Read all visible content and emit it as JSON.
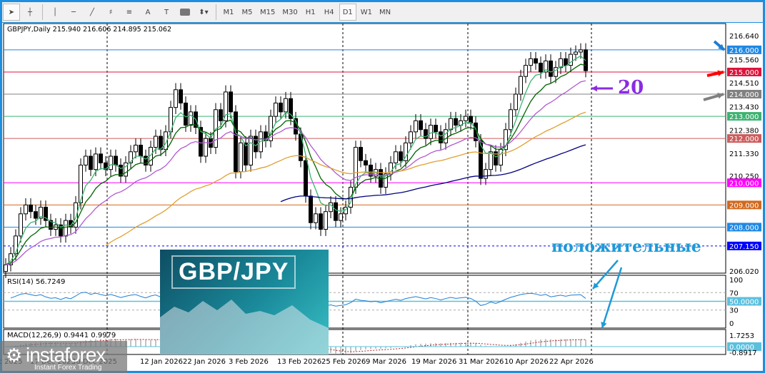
{
  "toolbar": {
    "timeframes": [
      "M1",
      "M5",
      "M15",
      "M30",
      "H1",
      "H4",
      "D1",
      "W1",
      "MN"
    ],
    "selected": "D1",
    "text_tool": "A"
  },
  "chart": {
    "header": "GBPJPY,Daily  215.940 216.606 214.895 215.062",
    "price_scale": [
      "216.640",
      "215.560",
      "214.510",
      "213.430",
      "212.380",
      "211.330",
      "210.250",
      "206.020"
    ],
    "levels": [
      {
        "price": 216.0,
        "label": "216.000",
        "color": "#1e88e5"
      },
      {
        "price": 215.0,
        "label": "215.000",
        "color": "#dc143c"
      },
      {
        "price": 214.0,
        "label": "214.000",
        "color": "#808080"
      },
      {
        "price": 213.0,
        "label": "213.000",
        "color": "#3cb371"
      },
      {
        "price": 212.0,
        "label": "212.000",
        "color": "#cd5c5c"
      },
      {
        "price": 210.0,
        "label": "210.000",
        "color": "#ff00ff"
      },
      {
        "price": 209.0,
        "label": "209.000",
        "color": "#d2691e"
      },
      {
        "price": 208.0,
        "label": "208.000",
        "color": "#1e88e5"
      },
      {
        "price": 207.15,
        "label": "207.150",
        "color": "#0000ff"
      }
    ],
    "dates": [
      "5 Dec 2025",
      "17 Dec 2025",
      "30 Dec 2025",
      "12 Jan 2026",
      "22 Jan 2026",
      "3 Feb 2026",
      "13 Feb 2026",
      "25 Feb 2026",
      "9 Mar 2026",
      "19 Mar 2026",
      "31 Mar 2026",
      "10 Apr 2026",
      "22 Apr 2026"
    ],
    "closes": [
      206.3,
      206.8,
      207.6,
      208.6,
      209.0,
      208.7,
      208.4,
      208.9,
      208.3,
      207.9,
      208.1,
      207.6,
      208.3,
      208.0,
      209.1,
      210.8,
      211.2,
      210.6,
      211.3,
      210.9,
      210.6,
      211.2,
      210.8,
      210.3,
      210.9,
      211.4,
      211.7,
      211.2,
      210.8,
      211.6,
      212.1,
      211.5,
      212.3,
      213.4,
      214.2,
      213.6,
      212.6,
      213.2,
      212.5,
      211.2,
      212.0,
      211.6,
      213.3,
      212.8,
      214.1,
      213.2,
      210.5,
      211.8,
      210.8,
      212.1,
      211.4,
      212.3,
      211.9,
      213.0,
      213.6,
      213.2,
      213.8,
      212.9,
      212.2,
      211.0,
      209.4,
      208.2,
      208.6,
      207.9,
      208.7,
      209.1,
      208.3,
      208.6,
      208.9,
      209.8,
      211.6,
      211.0,
      210.8,
      210.3,
      210.6,
      209.8,
      210.4,
      210.9,
      211.4,
      211.0,
      211.8,
      212.3,
      212.8,
      212.4,
      212.0,
      212.6,
      212.3,
      211.8,
      212.4,
      212.9,
      212.6,
      212.8,
      213.0,
      212.7,
      211.9,
      210.2,
      210.6,
      211.4,
      210.8,
      211.5,
      212.4,
      213.3,
      214.0,
      214.8,
      215.3,
      215.6,
      215.4,
      215.0,
      215.5,
      214.8,
      215.2,
      215.6,
      215.3,
      215.8,
      215.9,
      216.0,
      215.06
    ],
    "ma_colors": {
      "ma5": "#3cb371",
      "ma10": "#006400",
      "ma20": "#b05ad0",
      "ma50": "#e0a030",
      "ma100": "#000080"
    }
  },
  "rsi": {
    "label": "RSI(14) 56.7249",
    "scale": [
      "100",
      "70",
      "50.0000",
      "30",
      "0"
    ]
  },
  "macd": {
    "label": "MACD(12,26,9) 0.9441 0.9979",
    "scale": [
      "1.7253",
      "0.0000",
      "-0.8917"
    ]
  },
  "annotations": {
    "twenty": "20",
    "positive": "положительные"
  },
  "overlay": {
    "title": "GBP/JPY"
  },
  "logo": {
    "name": "instaforex",
    "slogan": "Instant Forex Trading"
  }
}
